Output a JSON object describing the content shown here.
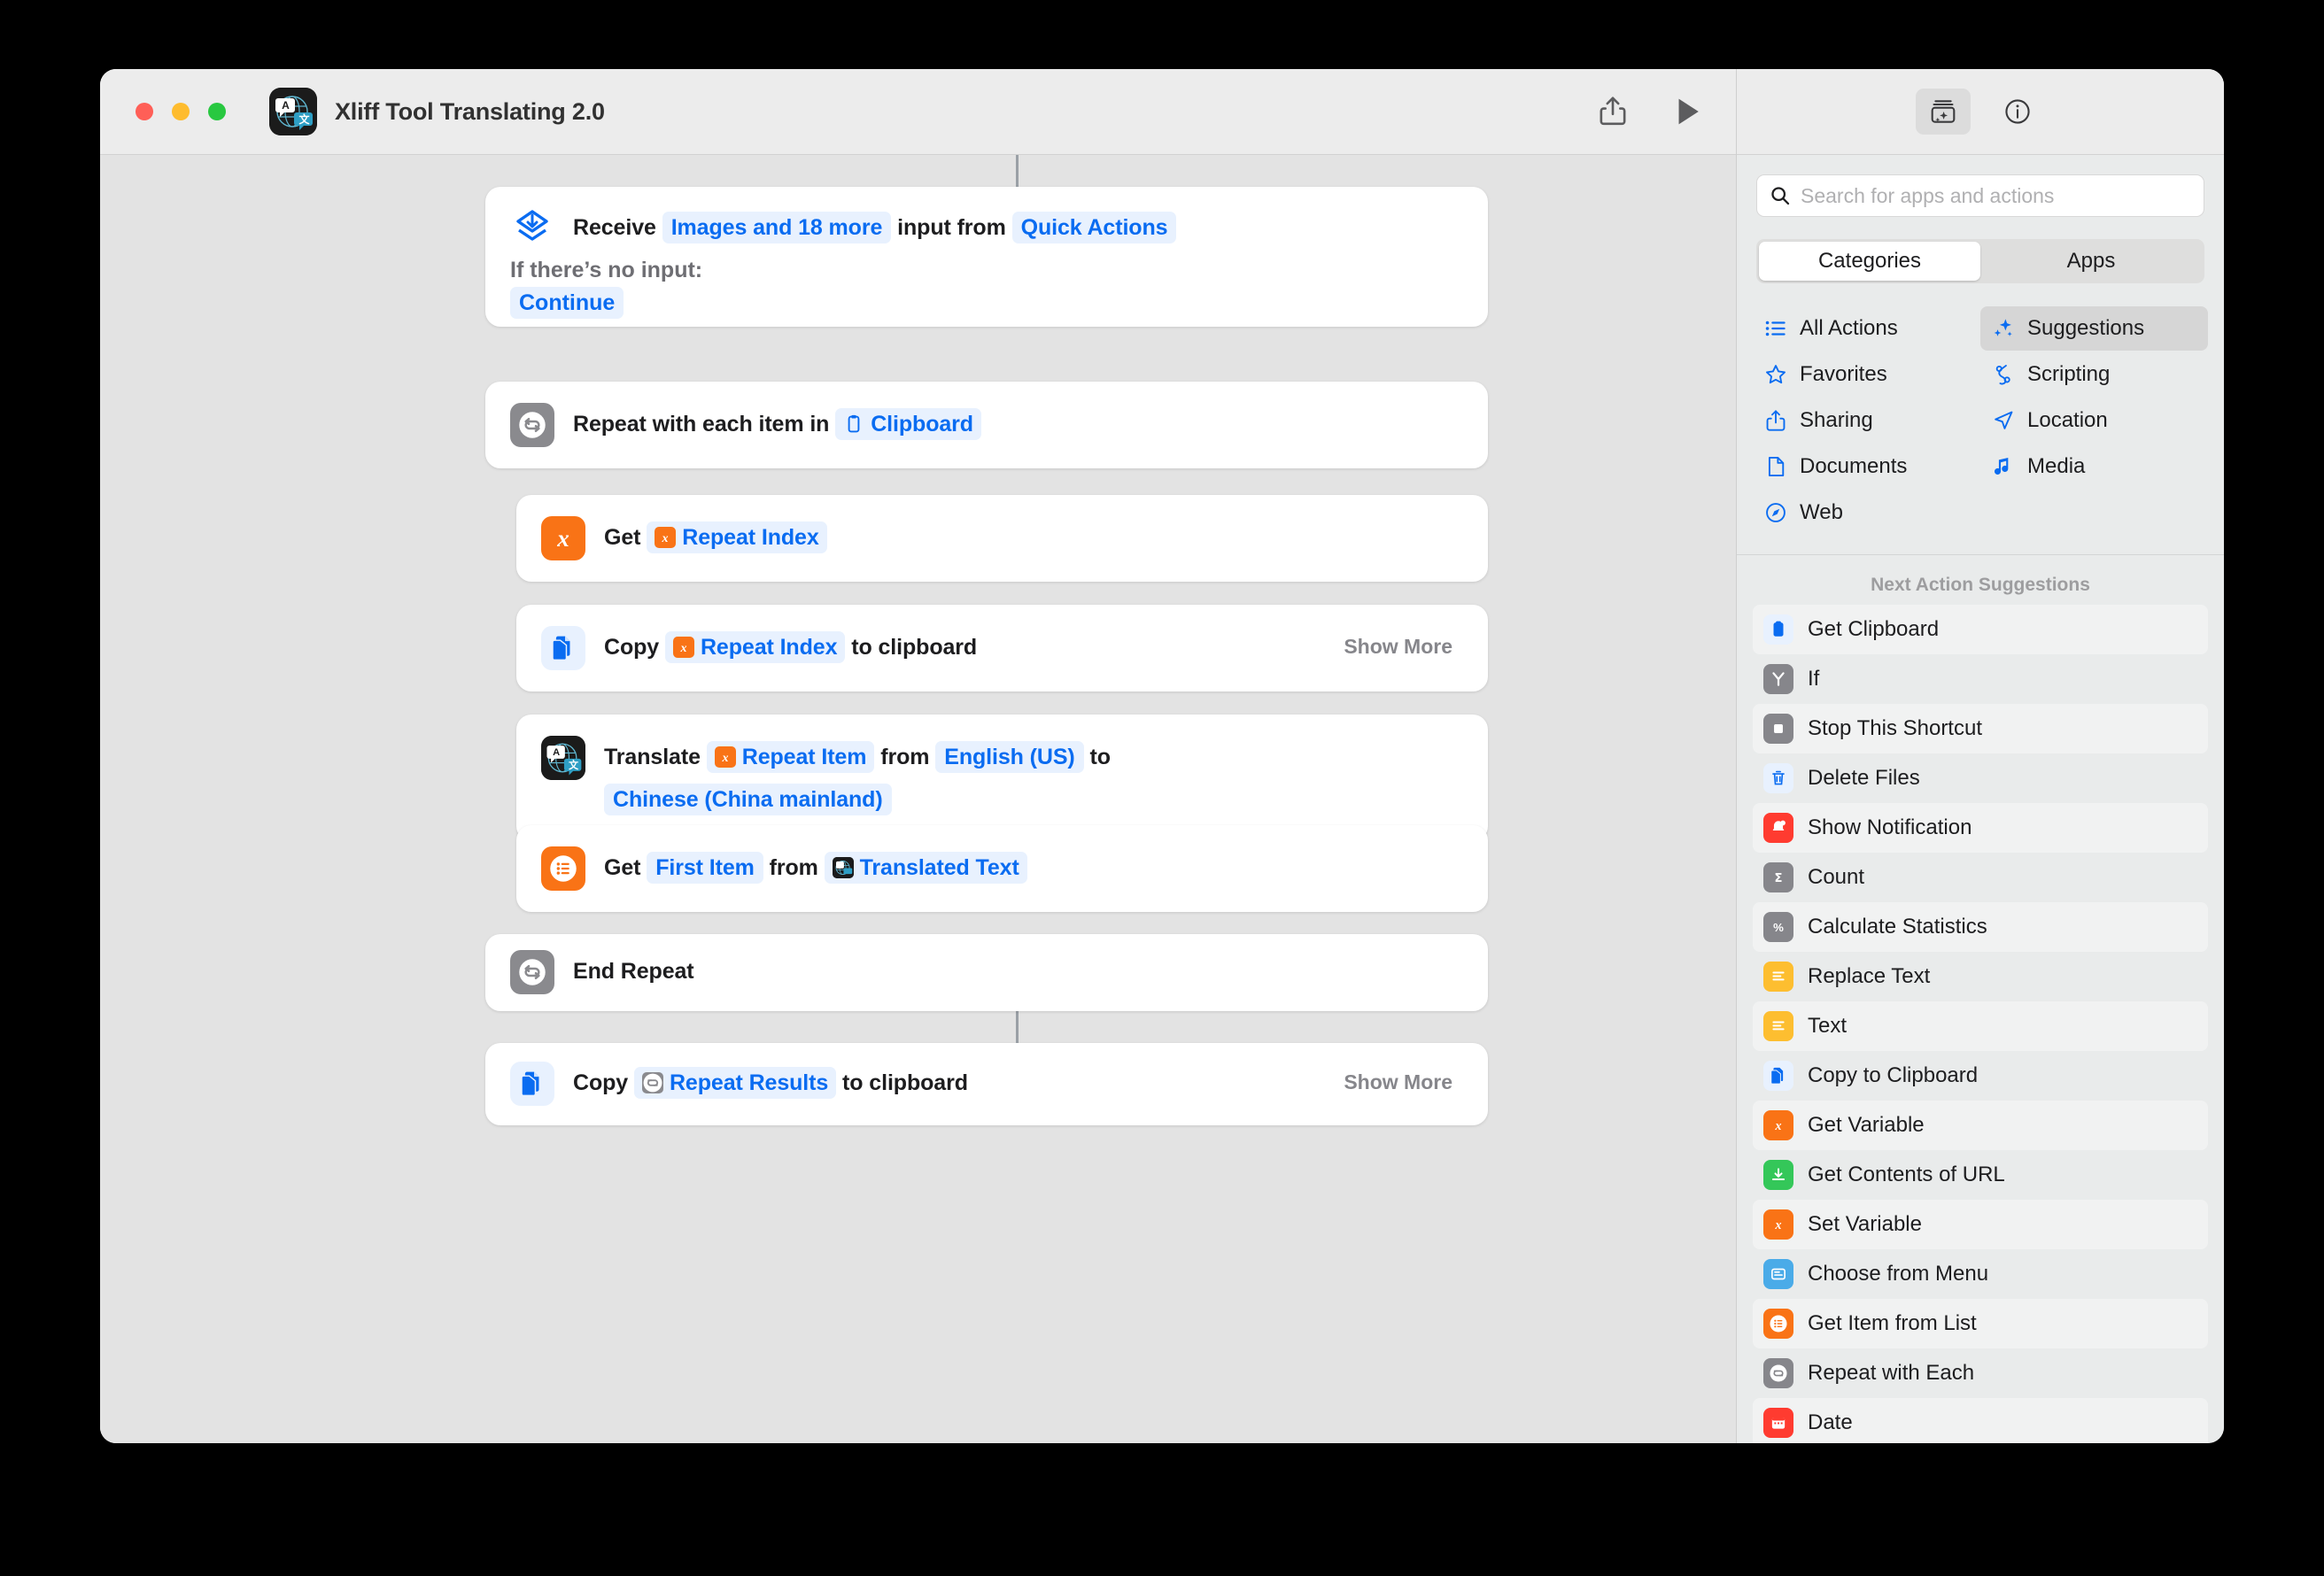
{
  "window": {
    "title": "Xliff Tool Translating 2.0",
    "app_icon": "translate-app-icon",
    "traffic_lights": [
      "close",
      "minimize",
      "zoom"
    ],
    "toolbar": {
      "share_label": "share-icon",
      "run_label": "play-icon"
    }
  },
  "workflow": {
    "actions": [
      {
        "id": "receive-input",
        "icon": "receive-input-icon",
        "icon_color": "#ffffff",
        "segments": [
          {
            "type": "plain",
            "text": "Receive"
          },
          {
            "type": "token",
            "text": "Images and 18 more"
          },
          {
            "type": "plain",
            "text": "input from"
          },
          {
            "type": "token",
            "text": "Quick Actions"
          }
        ],
        "sub_label": "If there’s no input:",
        "sub_token": "Continue",
        "show_more": null
      },
      {
        "id": "repeat-with-each",
        "icon": "repeat-icon",
        "icon_color": "#8a8a8e",
        "segments": [
          {
            "type": "plain",
            "text": "Repeat with each item in"
          },
          {
            "type": "token",
            "text": "Clipboard",
            "token_icon": "clipboard-icon"
          }
        ],
        "show_more": null
      },
      {
        "id": "get-repeat-index",
        "icon": "variable-icon",
        "icon_color": "#f97316",
        "segments": [
          {
            "type": "plain",
            "text": "Get"
          },
          {
            "type": "token",
            "text": "Repeat Index",
            "token_icon": "variable-icon"
          }
        ],
        "show_more": null
      },
      {
        "id": "copy-repeat-index",
        "icon": "copy-clipboard-icon",
        "icon_color": "#e8f1fe",
        "segments": [
          {
            "type": "plain",
            "text": "Copy"
          },
          {
            "type": "token",
            "text": "Repeat Index",
            "token_icon": "variable-icon"
          },
          {
            "type": "plain",
            "text": "to clipboard"
          }
        ],
        "show_more": "Show More"
      },
      {
        "id": "translate-text",
        "icon": "translate-app-icon",
        "icon_color": "#1b1b1b",
        "segments": [
          {
            "type": "plain",
            "text": "Translate"
          },
          {
            "type": "token",
            "text": "Repeat Item",
            "token_icon": "variable-icon"
          },
          {
            "type": "plain",
            "text": "from"
          },
          {
            "type": "token",
            "text": "English (US)"
          },
          {
            "type": "plain",
            "text": "to"
          },
          {
            "type": "token",
            "text": "Chinese (China mainland)"
          }
        ],
        "show_more": null
      },
      {
        "id": "get-first-item",
        "icon": "list-icon",
        "icon_color": "#f97316",
        "segments": [
          {
            "type": "plain",
            "text": "Get"
          },
          {
            "type": "token",
            "text": "First Item"
          },
          {
            "type": "plain",
            "text": "from"
          },
          {
            "type": "token",
            "text": "Translated Text",
            "token_icon": "translate-app-icon"
          }
        ],
        "show_more": null
      },
      {
        "id": "end-repeat",
        "icon": "repeat-icon",
        "icon_color": "#8a8a8e",
        "segments": [
          {
            "type": "plain",
            "text": "End Repeat"
          }
        ],
        "show_more": null
      },
      {
        "id": "copy-repeat-results",
        "icon": "copy-clipboard-icon",
        "icon_color": "#e8f1fe",
        "segments": [
          {
            "type": "plain",
            "text": "Copy"
          },
          {
            "type": "token",
            "text": "Repeat Results",
            "token_icon": "repeat-icon"
          },
          {
            "type": "plain",
            "text": "to clipboard"
          }
        ],
        "show_more": "Show More"
      }
    ]
  },
  "sidebar": {
    "top_buttons": [
      {
        "name": "action-library-icon",
        "active": true
      },
      {
        "name": "info-icon",
        "active": false
      }
    ],
    "search": {
      "placeholder": "Search for apps and actions",
      "value": "",
      "icon": "search-icon"
    },
    "segmented": {
      "options": [
        "Categories",
        "Apps"
      ],
      "selected": "Categories"
    },
    "categories": [
      {
        "label": "All Actions",
        "icon": "list-bullet-icon",
        "active": false
      },
      {
        "label": "Suggestions",
        "icon": "sparkles-icon",
        "active": true
      },
      {
        "label": "Favorites",
        "icon": "star-icon",
        "active": false
      },
      {
        "label": "Scripting",
        "icon": "scripting-icon",
        "active": false
      },
      {
        "label": "Sharing",
        "icon": "share-icon",
        "active": false
      },
      {
        "label": "Location",
        "icon": "location-arrow-icon",
        "active": false
      },
      {
        "label": "Documents",
        "icon": "document-icon",
        "active": false
      },
      {
        "label": "Media",
        "icon": "music-note-icon",
        "active": false
      },
      {
        "label": "Web",
        "icon": "compass-icon",
        "active": false
      }
    ],
    "suggestions_header": "Next Action Suggestions",
    "suggestions": [
      {
        "label": "Get Clipboard",
        "icon": "clipboard-icon",
        "color": "#e8f1fe",
        "glyph_color": "#0a6cf1"
      },
      {
        "label": "If",
        "icon": "branch-icon",
        "color": "#86868b",
        "glyph_color": "#ffffff"
      },
      {
        "label": "Stop This Shortcut",
        "icon": "stop-icon",
        "color": "#86868b",
        "glyph_color": "#ffffff"
      },
      {
        "label": "Delete Files",
        "icon": "trash-icon",
        "color": "#e8f1fe",
        "glyph_color": "#0a6cf1"
      },
      {
        "label": "Show Notification",
        "icon": "bell-icon",
        "color": "#ff3b30",
        "glyph_color": "#ffffff"
      },
      {
        "label": "Count",
        "icon": "sigma-icon",
        "color": "#86868b",
        "glyph_color": "#ffffff"
      },
      {
        "label": "Calculate Statistics",
        "icon": "percent-icon",
        "color": "#86868b",
        "glyph_color": "#ffffff"
      },
      {
        "label": "Replace Text",
        "icon": "text-lines-icon",
        "color": "#fdbe30",
        "glyph_color": "#ffffff"
      },
      {
        "label": "Text",
        "icon": "text-lines-icon",
        "color": "#fdbe30",
        "glyph_color": "#ffffff"
      },
      {
        "label": "Copy to Clipboard",
        "icon": "copy-clipboard-icon",
        "color": "#e8f1fe",
        "glyph_color": "#0a6cf1"
      },
      {
        "label": "Get Variable",
        "icon": "variable-icon",
        "color": "#f97316",
        "glyph_color": "#ffffff"
      },
      {
        "label": "Get Contents of URL",
        "icon": "download-icon",
        "color": "#34c759",
        "glyph_color": "#ffffff"
      },
      {
        "label": "Set Variable",
        "icon": "variable-icon",
        "color": "#f97316",
        "glyph_color": "#ffffff"
      },
      {
        "label": "Choose from Menu",
        "icon": "menu-card-icon",
        "color": "#4aabe8",
        "glyph_color": "#ffffff"
      },
      {
        "label": "Get Item from List",
        "icon": "list-icon",
        "color": "#f97316",
        "glyph_color": "#ffffff"
      },
      {
        "label": "Repeat with Each",
        "icon": "repeat-icon",
        "color": "#86868b",
        "glyph_color": "#ffffff"
      },
      {
        "label": "Date",
        "icon": "calendar-icon",
        "color": "#ff3b30",
        "glyph_color": "#ffffff"
      }
    ]
  },
  "colors": {
    "accent": "#0a6cf1",
    "token_bg": "#e8f1fe",
    "canvas_bg": "#e3e3e3",
    "sidebar_bg": "#e9ebeb"
  }
}
